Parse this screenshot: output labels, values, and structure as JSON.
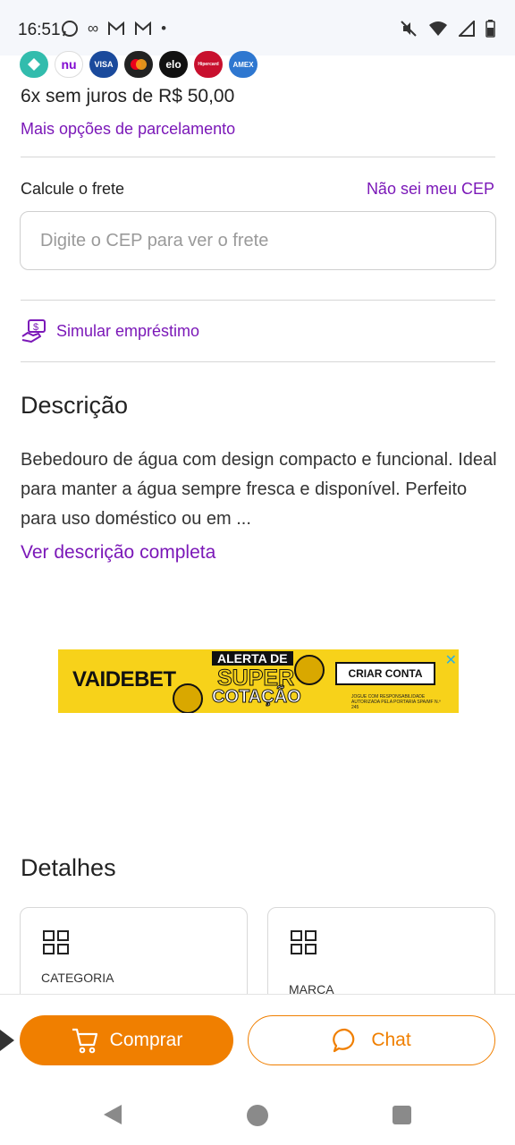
{
  "status_bar": {
    "time": "16:51",
    "icons_left": [
      "whatsapp-icon",
      "infinity-icon",
      "gmail-icon",
      "gmail-icon",
      "dot-icon"
    ],
    "icons_right": [
      "mute-icon",
      "wifi-icon",
      "signal-icon",
      "battery-icon"
    ]
  },
  "payment": {
    "logos": [
      {
        "name": "pix",
        "text": "",
        "color": "#32bcad"
      },
      {
        "name": "nubank",
        "text": "nu",
        "color": "#ffffff"
      },
      {
        "name": "visa",
        "text": "VISA",
        "color": "#1a4a9c"
      },
      {
        "name": "mastercard",
        "text": "",
        "color": "#222222"
      },
      {
        "name": "elo",
        "text": "elo",
        "color": "#111111"
      },
      {
        "name": "hipercard",
        "text": "Hipercard",
        "color": "#c8102e"
      },
      {
        "name": "amex",
        "text": "AMEX",
        "color": "#2e77d0"
      }
    ],
    "installments": "6x sem juros de R$ 50,00",
    "more_options": "Mais opções de parcelamento"
  },
  "freight": {
    "label": "Calcule o frete",
    "unknown_cep_link": "Não sei meu CEP",
    "input_placeholder": "Digite o CEP para ver o frete"
  },
  "loan": {
    "label": "Simular empréstimo"
  },
  "description": {
    "title": "Descrição",
    "text": "Bebedouro de água com design compacto e funcional. Ideal para manter a água sempre fresca e disponível. Perfeito para uso doméstico ou em ...",
    "see_full": "Ver descrição completa"
  },
  "ad": {
    "brand": "VAIDEBET",
    "headline_top": "ALERTA DE",
    "headline_mid": "SUPER",
    "headline_bottom": "COTAÇÃO",
    "cta": "CRIAR CONTA",
    "small_print": "JOGUE COM RESPONSABILIDADE AUTORIZADA PELA PORTARIA SPA/MF N.º 245"
  },
  "details": {
    "title": "Detalhes",
    "cards": [
      {
        "label": "CATEGORIA"
      },
      {
        "label": "MARCA"
      }
    ]
  },
  "actions": {
    "buy_label": "Comprar",
    "chat_label": "Chat"
  },
  "colors": {
    "accent_purple": "#7b18b8",
    "accent_orange": "#f07f00"
  }
}
